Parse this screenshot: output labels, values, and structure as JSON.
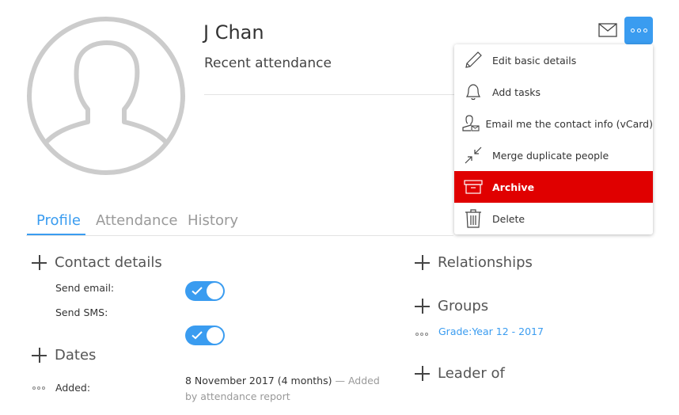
{
  "person": {
    "name": "J Chan",
    "subtitle": "Recent attendance"
  },
  "actions_menu": {
    "items": [
      {
        "label": "Edit basic details",
        "icon": "pencil-icon"
      },
      {
        "label": "Add tasks",
        "icon": "bell-icon"
      },
      {
        "label": "Email me the contact info (vCard)",
        "icon": "contact-email-icon"
      },
      {
        "label": "Merge duplicate people",
        "icon": "merge-icon"
      },
      {
        "label": "Archive",
        "icon": "archive-box-icon",
        "highlighted": true
      },
      {
        "label": "Delete",
        "icon": "trash-icon"
      }
    ]
  },
  "tabs": [
    {
      "label": "Profile",
      "active": true
    },
    {
      "label": "Attendance",
      "active": false
    },
    {
      "label": "History",
      "active": false
    }
  ],
  "contact_details": {
    "heading": "Contact details",
    "send_email_label": "Send email:",
    "send_email_on": true,
    "send_sms_label": "Send SMS:",
    "send_sms_on": true
  },
  "dates": {
    "heading": "Dates",
    "added_label": "Added:",
    "added_value": "8 November 2017 (4 months)",
    "added_note": "— Added by attendance report"
  },
  "relationships": {
    "heading": "Relationships"
  },
  "groups": {
    "heading": "Groups",
    "items": [
      "Grade:Year 12 - 2017"
    ]
  },
  "leader_of": {
    "heading": "Leader of"
  },
  "colors": {
    "accent": "#3a9cf0",
    "danger": "#e00000",
    "avatar_gray": "#cccccc"
  }
}
